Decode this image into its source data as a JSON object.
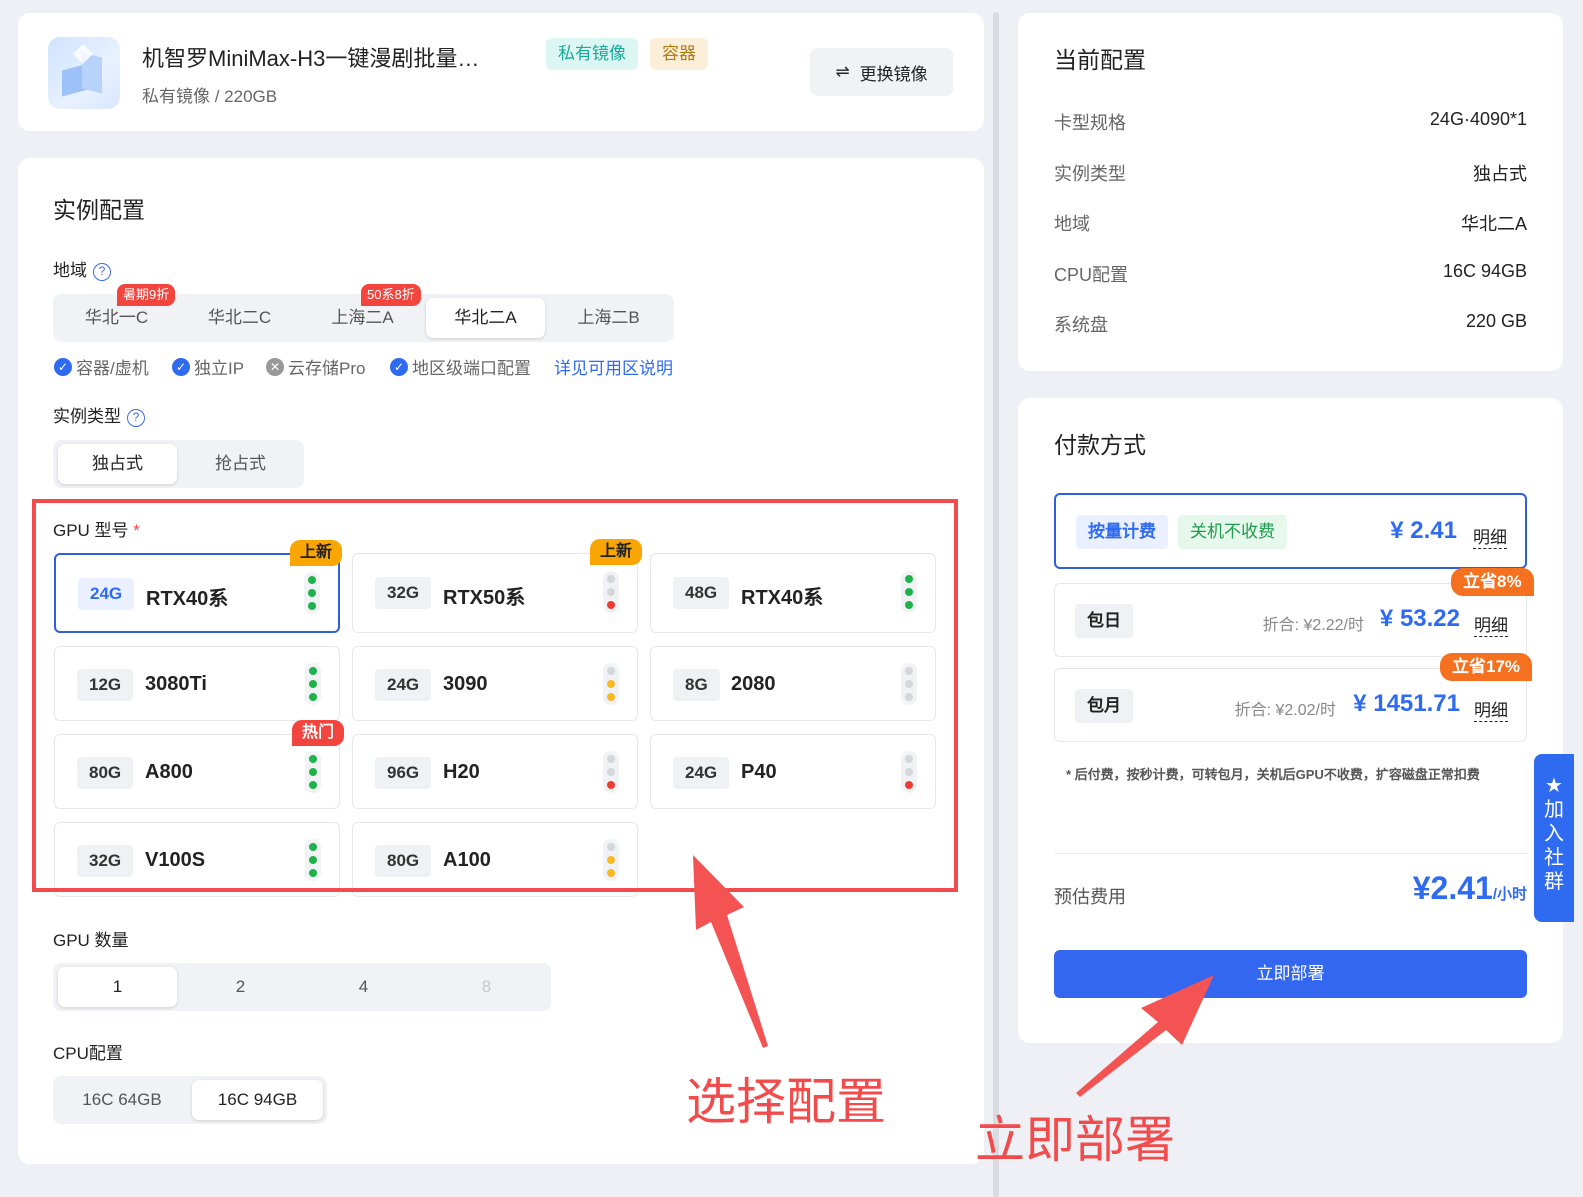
{
  "image": {
    "title": "机智罗MiniMax-H3一键漫剧批量…",
    "subtitle": "私有镜像 / 220GB",
    "tags": [
      "私有镜像",
      "容器"
    ],
    "swap_label": "更换镜像"
  },
  "instance": {
    "heading": "实例配置",
    "region_label": "地域",
    "regions": [
      {
        "name": "华北一C",
        "badge": "暑期9折"
      },
      {
        "name": "华北二C",
        "badge": ""
      },
      {
        "name": "上海二A",
        "badge": "50系8折"
      },
      {
        "name": "华北二A",
        "badge": ""
      },
      {
        "name": "上海二B",
        "badge": ""
      }
    ],
    "selected_region": "华北二A",
    "features": [
      "容器/虚机",
      "独立IP",
      "云存储Pro",
      "地区级端口配置"
    ],
    "features_link": "详见可用区说明",
    "type_label": "实例类型",
    "types": [
      "独占式",
      "抢占式"
    ],
    "selected_type": "独占式",
    "gpu_label": "GPU 型号",
    "gpu_required_mark": "*",
    "gpus": [
      {
        "mem": "24G",
        "name": "RTX40系",
        "badge": "上新",
        "stock": "high"
      },
      {
        "mem": "32G",
        "name": "RTX50系",
        "badge": "上新",
        "stock": "low"
      },
      {
        "mem": "48G",
        "name": "RTX40系",
        "badge": "",
        "stock": "high"
      },
      {
        "mem": "12G",
        "name": "3080Ti",
        "badge": "",
        "stock": "high"
      },
      {
        "mem": "24G",
        "name": "3090",
        "badge": "",
        "stock": "medium"
      },
      {
        "mem": "8G",
        "name": "2080",
        "badge": "",
        "stock": "none"
      },
      {
        "mem": "80G",
        "name": "A800",
        "badge": "热门",
        "stock": "high"
      },
      {
        "mem": "96G",
        "name": "H20",
        "badge": "",
        "stock": "low"
      },
      {
        "mem": "24G",
        "name": "P40",
        "badge": "",
        "stock": "low"
      },
      {
        "mem": "32G",
        "name": "V100S",
        "badge": "",
        "stock": "high"
      },
      {
        "mem": "80G",
        "name": "A100",
        "badge": "",
        "stock": "medium"
      }
    ],
    "gpu_count_label": "GPU 数量",
    "gpu_counts": [
      "1",
      "2",
      "4",
      "8"
    ],
    "selected_gpu_count": "1",
    "cpu_label": "CPU配置",
    "cpu_options": [
      "16C 64GB",
      "16C 94GB"
    ],
    "selected_cpu": "16C 94GB"
  },
  "current": {
    "heading": "当前配置",
    "rows": [
      {
        "k": "卡型规格",
        "v": "24G·4090*1"
      },
      {
        "k": "实例类型",
        "v": "独占式"
      },
      {
        "k": "地域",
        "v": "华北二A"
      },
      {
        "k": "CPU配置",
        "v": "16C 94GB"
      },
      {
        "k": "系统盘",
        "v": "220 GB"
      }
    ]
  },
  "payment": {
    "heading": "付款方式",
    "plans": [
      {
        "name": "按量计费",
        "extra": "关机不收费",
        "equiv": "",
        "price": "¥ 2.41",
        "detail": "明细",
        "save": ""
      },
      {
        "name": "包日",
        "extra": "",
        "equiv": "折合: ¥2.22/时",
        "price": "¥ 53.22",
        "detail": "明细",
        "save": "立省8%"
      },
      {
        "name": "包月",
        "extra": "",
        "equiv": "折合: ¥2.02/时",
        "price": "¥ 1451.71",
        "detail": "明细",
        "save": "立省17%"
      }
    ],
    "note": "* 后付费，按秒计费，可转包月，关机后GPU不收费，扩容磁盘正常扣费",
    "estimate_label": "预估费用",
    "estimate_value": "¥2.41",
    "estimate_unit": "/小时",
    "deploy_label": "立即部署"
  },
  "side_tab": {
    "label": [
      "加",
      "入",
      "社",
      "群"
    ]
  },
  "annotations": {
    "select": "选择配置",
    "deploy": "立即部署"
  },
  "colors": {
    "primary": "#2f6bf0",
    "annotation": "#f14b4b",
    "badge_new": "#f9a605",
    "badge_hot": "#f2453d",
    "save": "#f5711f"
  }
}
